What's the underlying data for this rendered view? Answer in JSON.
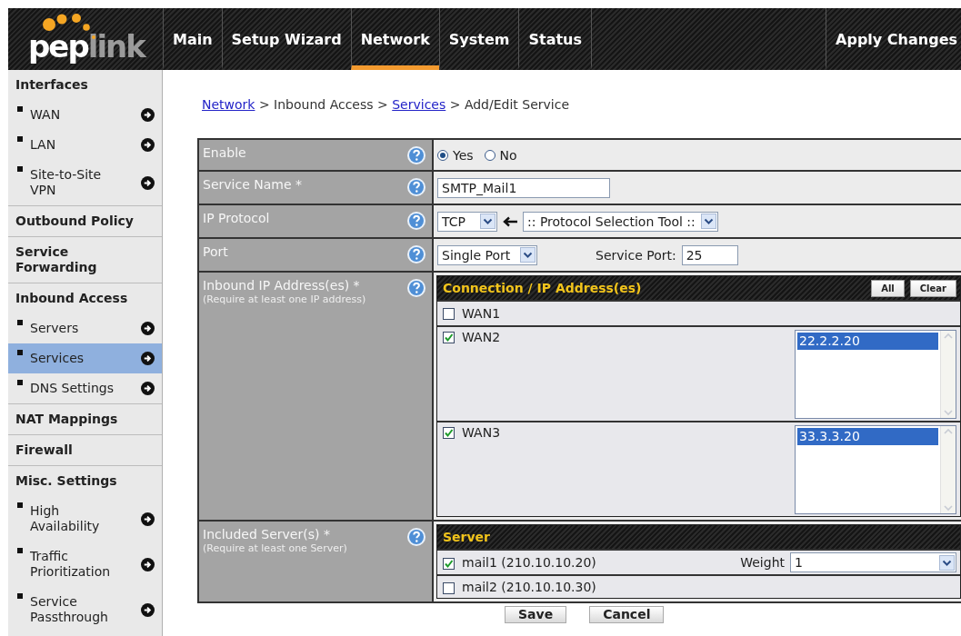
{
  "logo": {
    "text_main": "pep",
    "text_dim": "link"
  },
  "nav": {
    "tabs": [
      {
        "label": "Main",
        "selected": false
      },
      {
        "label": "Setup Wizard",
        "selected": false
      },
      {
        "label": "Network",
        "selected": true
      },
      {
        "label": "System",
        "selected": false
      },
      {
        "label": "Status",
        "selected": false
      }
    ],
    "apply_button": "Apply Changes"
  },
  "sidebar": {
    "sections": [
      {
        "label": "Interfaces",
        "items": [
          {
            "label": "WAN",
            "selected": false
          },
          {
            "label": "LAN",
            "selected": false
          },
          {
            "label": "Site-to-Site VPN",
            "selected": false
          }
        ]
      },
      {
        "label": "Outbound Policy"
      },
      {
        "label": "Service Forwarding"
      },
      {
        "label": "Inbound Access",
        "items": [
          {
            "label": "Servers",
            "selected": false
          },
          {
            "label": "Services",
            "selected": true
          },
          {
            "label": "DNS Settings",
            "selected": false
          }
        ]
      },
      {
        "label": "NAT Mappings"
      },
      {
        "label": "Firewall"
      },
      {
        "label": "Misc. Settings",
        "items": [
          {
            "label": "High Availability",
            "selected": false
          },
          {
            "label": "Traffic Prioritization",
            "selected": false
          },
          {
            "label": "Service Passthrough",
            "selected": false
          }
        ]
      }
    ]
  },
  "breadcrumb": [
    {
      "kind": "link",
      "label": "Network"
    },
    {
      "kind": "text",
      "label": ">"
    },
    {
      "kind": "text",
      "label": "Inbound Access"
    },
    {
      "kind": "text",
      "label": ">"
    },
    {
      "kind": "link",
      "label": "Services"
    },
    {
      "kind": "text",
      "label": ">"
    },
    {
      "kind": "text",
      "label": "Add/Edit Service"
    }
  ],
  "form": [
    {
      "kind": "radio",
      "label": "Enable",
      "options": [
        {
          "label": "Yes",
          "selected": true
        },
        {
          "label": "No",
          "selected": false
        }
      ]
    },
    {
      "kind": "text",
      "label": "Service Name *",
      "value": "SMTP_Mail1"
    },
    {
      "kind": "protocol",
      "label": "IP Protocol",
      "protocol": "TCP",
      "tool": ":: Protocol Selection Tool ::"
    },
    {
      "kind": "port",
      "label": "Port",
      "port_type": "Single Port",
      "port_label": "Service Port:",
      "port_value": "25"
    },
    {
      "kind": "connections",
      "label": "Inbound IP Address(es) *",
      "note": "(Require at least one IP address)",
      "panel": {
        "title": "Connection / IP Address(es)",
        "buttons": [
          "All",
          "Clear"
        ],
        "rows": [
          {
            "name": "WAN1",
            "checked": false
          },
          {
            "name": "WAN2",
            "checked": true,
            "addresses": [
              {
                "value": "22.2.2.20",
                "selected": true
              }
            ]
          },
          {
            "name": "WAN3",
            "checked": true,
            "addresses": [
              {
                "value": "33.3.3.20",
                "selected": true
              }
            ]
          }
        ]
      }
    },
    {
      "kind": "servers",
      "label": "Included Server(s) *",
      "note": "(Require at least one Server)",
      "panel": {
        "title": "Server",
        "rows": [
          {
            "name": "mail1 (210.10.10.20)",
            "checked": true,
            "weight_label": "Weight",
            "weight": "1"
          },
          {
            "name": "mail2 (210.10.10.30)",
            "checked": false
          }
        ]
      }
    }
  ],
  "buttons": [
    "Save",
    "Cancel"
  ]
}
